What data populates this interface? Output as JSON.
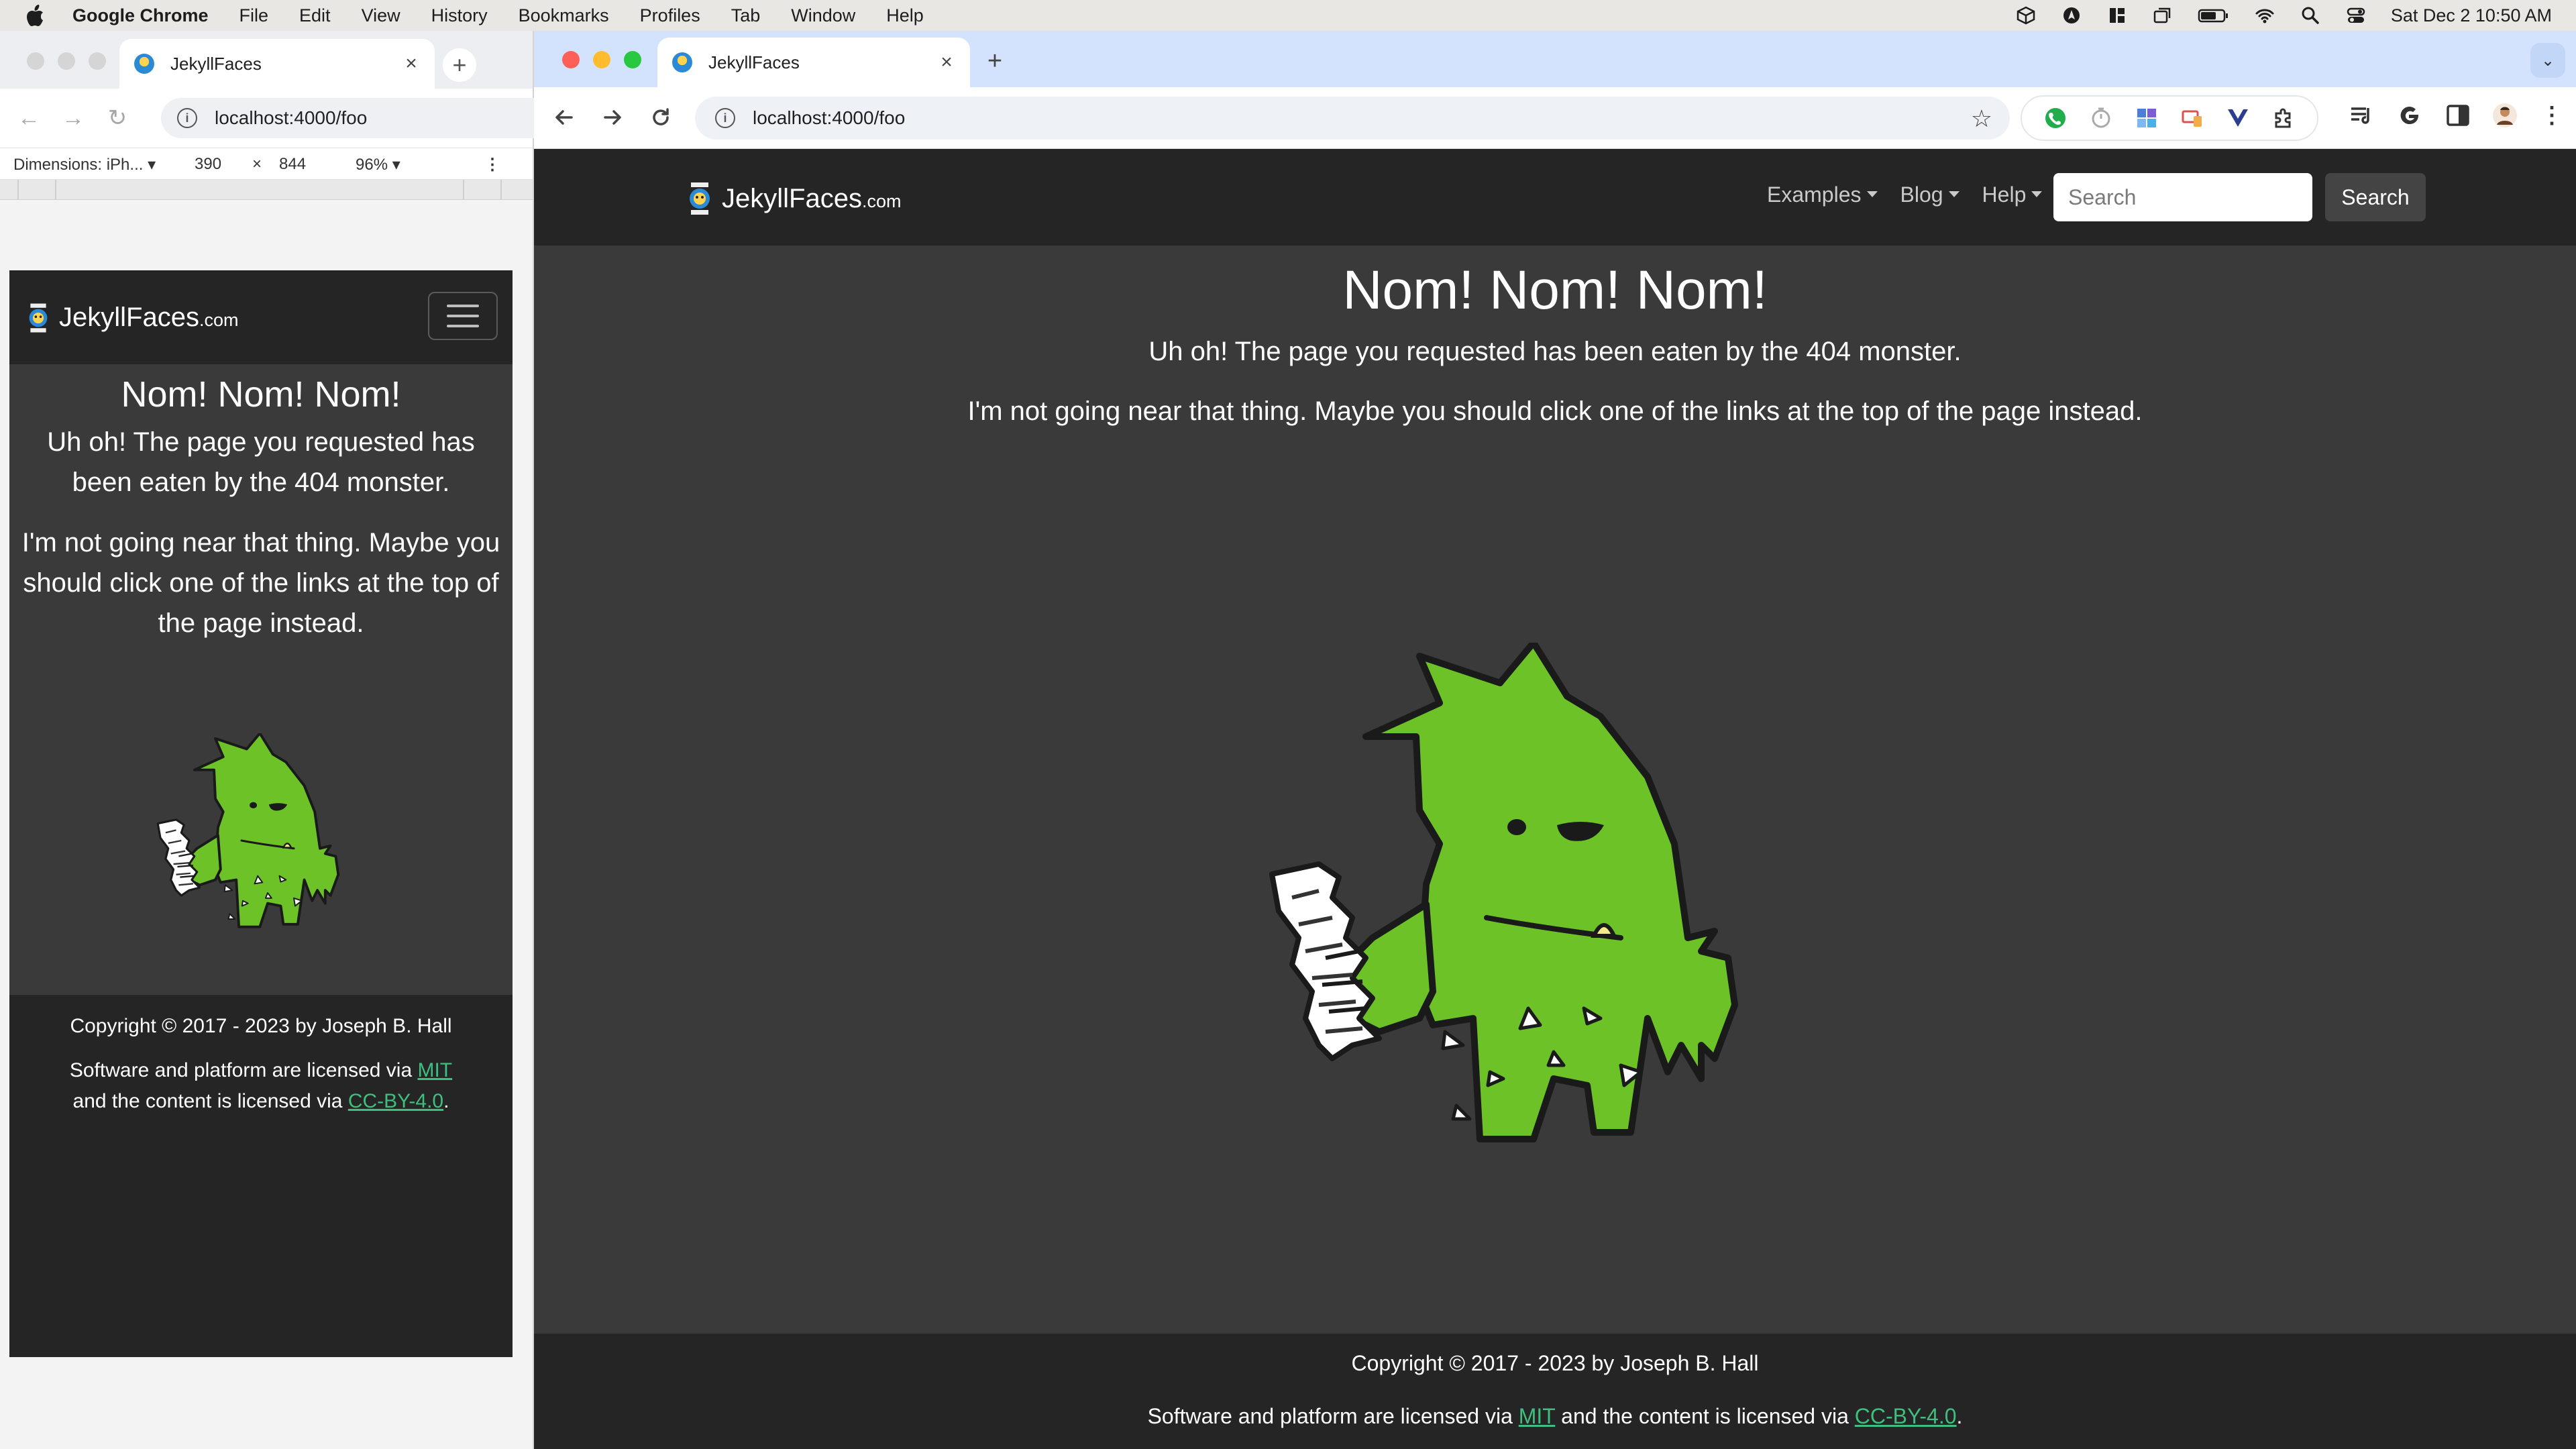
{
  "menubar": {
    "app_name": "Google Chrome",
    "items": [
      "File",
      "Edit",
      "View",
      "History",
      "Bookmarks",
      "Profiles",
      "Tab",
      "Window",
      "Help"
    ],
    "clock": "Sat Dec 2  10:50 AM"
  },
  "back_window": {
    "tab_title": "JekyllFaces",
    "url": "localhost:4000/foo",
    "device_toolbar": {
      "dimensions_label": "Dimensions: iPh...",
      "width": "390",
      "times": "×",
      "height": "844",
      "zoom": "96%"
    }
  },
  "front_window": {
    "tab_title": "JekyllFaces",
    "url": "localhost:4000/foo"
  },
  "site": {
    "brand": "JekyllFaces",
    "brand_suffix": ".com",
    "nav": [
      "Examples",
      "Blog",
      "Help"
    ],
    "search_placeholder": "Search",
    "search_button": "Search",
    "title": "Nom! Nom! Nom!",
    "message1": "Uh oh! The page you requested has been eaten by the 404 monster.",
    "message2": "I'm not going near that thing. Maybe you should click one of the links at the top of the page instead.",
    "copyright": "Copyright © 2017 - 2023 by Joseph B. Hall",
    "license_prefix": "Software and platform are licensed via ",
    "license_mit": "MIT",
    "license_middle": " and the content is licensed via ",
    "license_cc": "CC-BY-4.0",
    "license_end": "."
  },
  "colors": {
    "page_bg": "#3a3a3a",
    "nav_bg": "#252525",
    "link": "#3fbf7f",
    "monster_green": "#6cc226",
    "tab_strip": "#d3e3fd"
  }
}
